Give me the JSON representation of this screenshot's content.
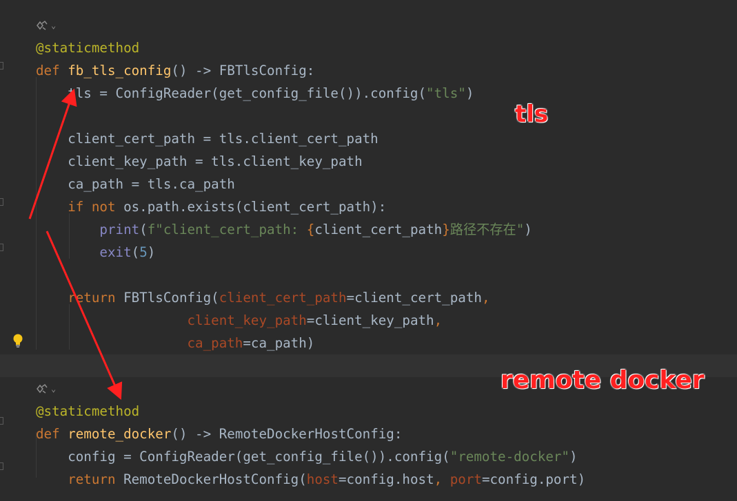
{
  "editor": {
    "lines": [
      {
        "id": "hint-1",
        "type": "hint"
      },
      {
        "id": "l1",
        "tokens": [
          [
            "deco",
            "@staticmethod"
          ]
        ]
      },
      {
        "id": "l2",
        "tokens": [
          [
            "kw",
            "def "
          ],
          [
            "fn",
            "fb_tls_config"
          ],
          [
            "",
            "() -> FBTlsConfig:"
          ]
        ]
      },
      {
        "id": "l3",
        "tokens": [
          [
            "",
            "    tls = ConfigReader(get_config_file()).config("
          ],
          [
            "str",
            "\"tls\""
          ],
          [
            "",
            ")"
          ]
        ]
      },
      {
        "id": "l4",
        "tokens": []
      },
      {
        "id": "l5",
        "tokens": [
          [
            "",
            "    client_cert_path = tls.client_cert_path"
          ]
        ]
      },
      {
        "id": "l6",
        "tokens": [
          [
            "",
            "    client_key_path = tls.client_key_path"
          ]
        ]
      },
      {
        "id": "l7",
        "tokens": [
          [
            "",
            "    ca_path = tls.ca_path"
          ]
        ]
      },
      {
        "id": "l8",
        "tokens": [
          [
            "kw",
            "    if not "
          ],
          [
            "",
            "os.path.exists(client_cert_path):"
          ]
        ]
      },
      {
        "id": "l9",
        "tokens": [
          [
            "builtin",
            "        print"
          ],
          [
            "",
            "("
          ],
          [
            "str",
            "f\"client_cert_path: "
          ],
          [
            "brace",
            "{"
          ],
          [
            "",
            "client_cert_path"
          ],
          [
            "brace",
            "}"
          ],
          [
            "str",
            "路径不存在\""
          ],
          [
            "",
            ")"
          ]
        ]
      },
      {
        "id": "l10",
        "tokens": [
          [
            "builtin",
            "        exit"
          ],
          [
            "",
            "("
          ],
          [
            "num",
            "5"
          ],
          [
            "",
            ")"
          ]
        ]
      },
      {
        "id": "l11",
        "tokens": []
      },
      {
        "id": "l12",
        "tokens": [
          [
            "kw",
            "    return "
          ],
          [
            "",
            "FBTlsConfig("
          ],
          [
            "param",
            "client_cert_path"
          ],
          [
            "",
            "=client_cert_path"
          ],
          [
            "kw",
            ","
          ]
        ]
      },
      {
        "id": "l13",
        "tokens": [
          [
            "",
            "                   "
          ],
          [
            "param",
            "client_key_path"
          ],
          [
            "",
            "=client_key_path"
          ],
          [
            "kw",
            ","
          ]
        ]
      },
      {
        "id": "l14",
        "tokens": [
          [
            "",
            "                   "
          ],
          [
            "param",
            "ca_path"
          ],
          [
            "",
            "=ca_path)"
          ]
        ]
      },
      {
        "id": "l15",
        "tokens": [],
        "highlight": true
      },
      {
        "id": "hint-2",
        "type": "hint"
      },
      {
        "id": "l16",
        "tokens": [
          [
            "deco",
            "@staticmethod"
          ]
        ]
      },
      {
        "id": "l17",
        "tokens": [
          [
            "kw",
            "def "
          ],
          [
            "fn",
            "remote_docker"
          ],
          [
            "",
            "() -> RemoteDockerHostConfig:"
          ]
        ]
      },
      {
        "id": "l18",
        "tokens": [
          [
            "",
            "    config = ConfigReader(get_config_file()).config("
          ],
          [
            "str",
            "\"remote-docker\""
          ],
          [
            "",
            ")"
          ]
        ]
      },
      {
        "id": "l19",
        "tokens": [
          [
            "kw",
            "    return "
          ],
          [
            "",
            "RemoteDockerHostConfig("
          ],
          [
            "param",
            "host"
          ],
          [
            "",
            "=config.host"
          ],
          [
            "kw",
            ", "
          ],
          [
            "param",
            "port"
          ],
          [
            "",
            "=config.port)"
          ]
        ]
      }
    ]
  },
  "annotations": {
    "tls_label": "tls",
    "remote_docker_label": "remote docker",
    "color": "#ff2020"
  },
  "colors": {
    "background": "#2b2b2b",
    "keyword": "#cc7832",
    "function": "#ffc66d",
    "decorator": "#bbb529",
    "string": "#6a8759",
    "number": "#6897bb",
    "parameter": "#aa4926",
    "builtin": "#8888c6"
  },
  "icons": {
    "hint": "inlay-hint-icon",
    "bulb": "lightbulb-icon"
  }
}
